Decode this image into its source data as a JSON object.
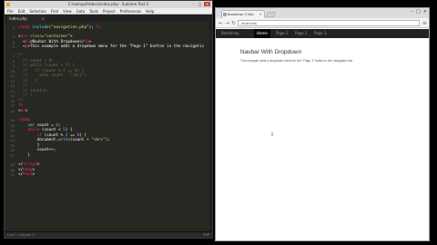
{
  "editor": {
    "title": "C:\\xampp\\htdocs\\index.php - Sublime Text 2",
    "menu": [
      "File",
      "Edit",
      "Selection",
      "Find",
      "View",
      "Goto",
      "Tools",
      "Project",
      "Preferences",
      "Help"
    ],
    "tab_label": "index.php",
    "status_left": "Line 1, Column 1",
    "status_right": "PHP"
  },
  "browser": {
    "tab_title": "Bootstrap 3 Nav",
    "url": "localhost/",
    "window_controls": [
      "–",
      "□",
      "×"
    ],
    "navbar": {
      "brand": "Bootstrap",
      "items": [
        "Home",
        "Page 1",
        "Page 2",
        "Page 3"
      ],
      "active_index": 0
    },
    "page": {
      "title": "Navbar With Dropdown",
      "description": "This example adds a dropdown menu for the \"Page 1\" button in the navigation bar."
    }
  }
}
